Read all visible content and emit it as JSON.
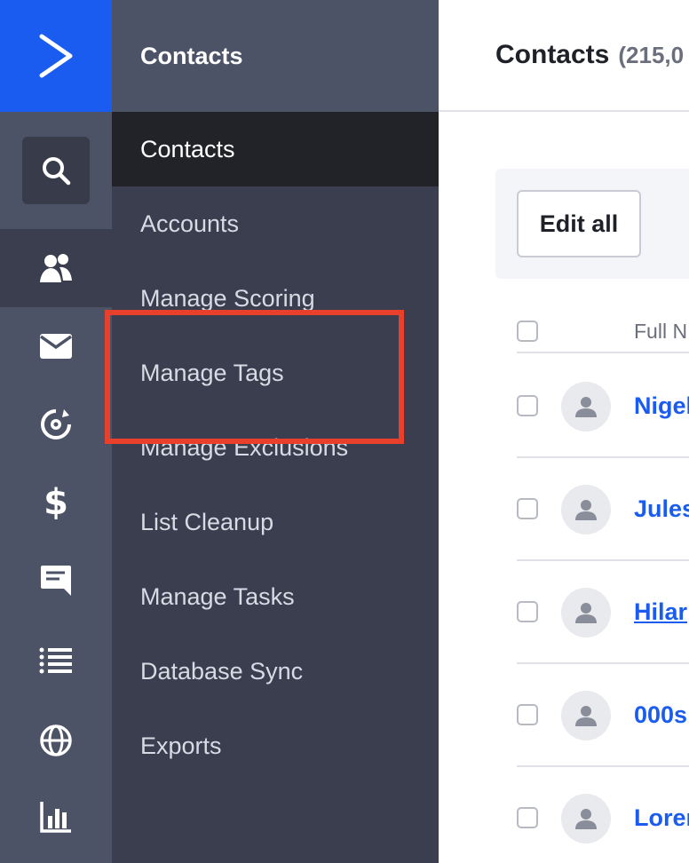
{
  "rail": {
    "items": [
      {
        "icon": "search-icon",
        "active": false
      },
      {
        "icon": "contacts-icon",
        "active": true
      },
      {
        "icon": "mail-icon",
        "active": false
      },
      {
        "icon": "automation-icon",
        "active": false
      },
      {
        "icon": "dollar-icon",
        "active": false
      },
      {
        "icon": "chat-icon",
        "active": false
      },
      {
        "icon": "list-icon",
        "active": false
      },
      {
        "icon": "globe-icon",
        "active": false
      },
      {
        "icon": "reports-icon",
        "active": false
      }
    ]
  },
  "subnav": {
    "title": "Contacts",
    "items": [
      {
        "label": "Contacts",
        "active": true
      },
      {
        "label": "Accounts"
      },
      {
        "label": "Manage Scoring"
      },
      {
        "label": "Manage Tags"
      },
      {
        "label": "Manage Exclusions"
      },
      {
        "label": "List Cleanup"
      },
      {
        "label": "Manage Tasks"
      },
      {
        "label": "Database Sync"
      },
      {
        "label": "Exports"
      }
    ]
  },
  "highlight": {
    "color": "#e8402a",
    "target": "Manage Tags"
  },
  "main": {
    "title": "Contacts",
    "count": "(215,0",
    "toolbar": {
      "edit_all_label": "Edit all"
    },
    "table": {
      "column_fullname": "Full N",
      "rows": [
        {
          "name": "Nigel"
        },
        {
          "name": "Jules"
        },
        {
          "name": "Hilar"
        },
        {
          "name": "000s"
        },
        {
          "name": "Lorer"
        }
      ]
    }
  },
  "colors": {
    "brand_blue": "#1b5cf0",
    "rail_bg": "#4d5366",
    "subnav_bg": "#3a3e4f",
    "active_item_bg": "#212329",
    "highlight_red": "#e8402a"
  }
}
